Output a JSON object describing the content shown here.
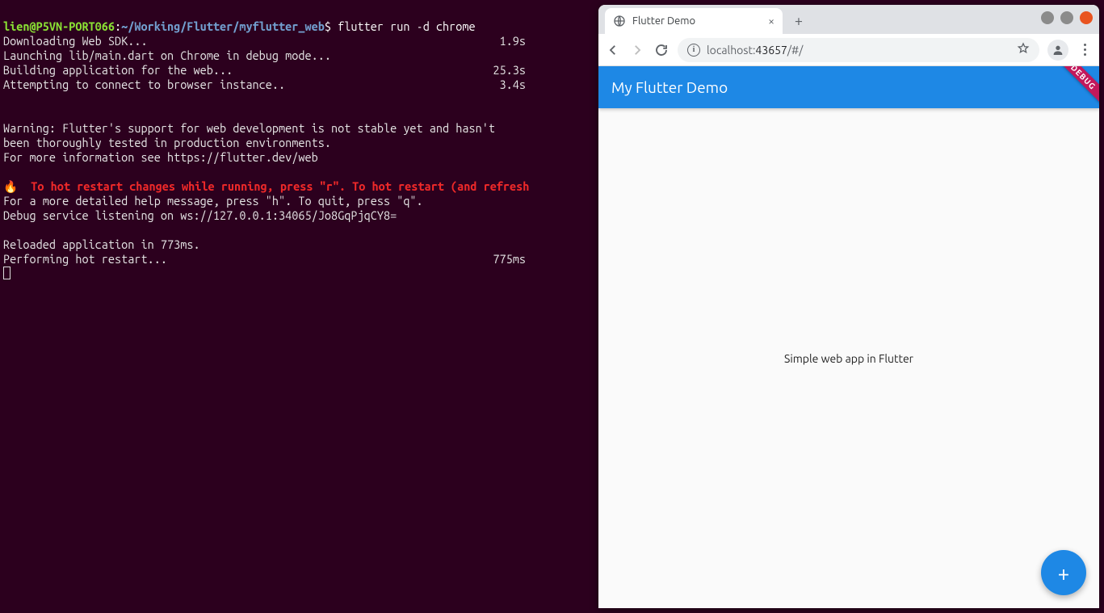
{
  "terminal": {
    "prompt_user": "lien@P5VN-PORT066",
    "prompt_sep": ":",
    "prompt_path": "~/Working/Flutter/myflutter_web",
    "prompt_end": "$ ",
    "command": "flutter run -d chrome",
    "lines": [
      {
        "l": "Downloading Web SDK...",
        "r": "1.9s"
      },
      {
        "l": "Launching lib/main.dart on Chrome in debug mode...",
        "r": ""
      },
      {
        "l": "Building application for the web...",
        "r": "25.3s"
      },
      {
        "l": "Attempting to connect to browser instance..",
        "r": "3.4s"
      }
    ],
    "blank1": " ",
    "warn1": "Warning: Flutter's support for web development is not stable yet and hasn't",
    "warn2": "been thoroughly tested in production environments.",
    "warn3": "For more information see https://flutter.dev/web",
    "blank2": " ",
    "hot_emoji": "🔥  ",
    "hot_text": "To hot restart changes while running, press \"r\". To hot restart (and refresh",
    "help": "For a more detailed help message, press \"h\". To quit, press \"q\".",
    "debug_service": "Debug service listening on ws://127.0.0.1:34065/Jo8GqPjqCY8=",
    "blank3": " ",
    "reloaded": "Reloaded application in 773ms.",
    "restart": {
      "l": "Performing hot restart...",
      "r": "775ms"
    }
  },
  "browser": {
    "tab_title": "Flutter Demo",
    "url_host": "localhost:",
    "url_port": "43657",
    "url_rest": "/#/"
  },
  "app": {
    "appbar_title": "My Flutter Demo",
    "body_text": "Simple web app in Flutter",
    "fab_label": "+",
    "debug_banner": "DEBUG"
  }
}
